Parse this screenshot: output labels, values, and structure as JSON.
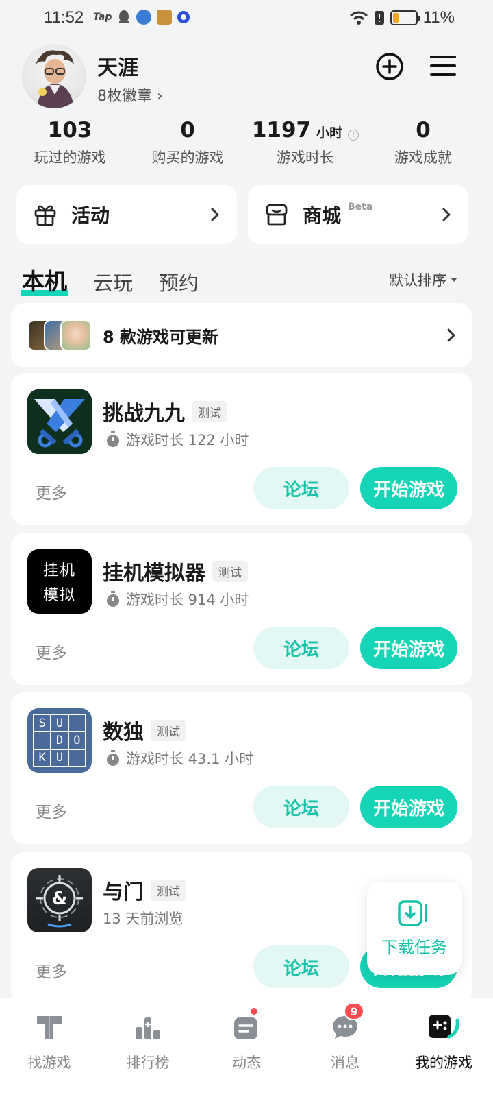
{
  "status_bar": {
    "time": "11:52",
    "tap_label": "Tap",
    "battery_percent": "11%",
    "battery_level": 0.11
  },
  "profile": {
    "username": "天涯",
    "badges": "8枚徽章 ›"
  },
  "stats": [
    {
      "value": "103",
      "unit": "",
      "label": "玩过的游戏"
    },
    {
      "value": "0",
      "unit": "",
      "label": "购买的游戏"
    },
    {
      "value": "1197",
      "unit": "小时",
      "label": "游戏时长"
    },
    {
      "value": "0",
      "unit": "",
      "label": "游戏成就"
    }
  ],
  "actions": {
    "activity": "活动",
    "store": "商城",
    "store_badge": "Beta"
  },
  "tabs": [
    "本机",
    "云玩",
    "预约"
  ],
  "sort_label": "默认排序",
  "update_bar": {
    "text": "8 款游戏可更新"
  },
  "games": [
    {
      "name": "挑战九九",
      "tag": "测试",
      "meta": "游戏时长 122 小时",
      "more": "更多",
      "forum": "论坛",
      "play": "开始游戏"
    },
    {
      "name": "挂机模拟器",
      "tag": "测试",
      "meta": "游戏时长 914 小时",
      "more": "更多",
      "forum": "论坛",
      "play": "开始游戏",
      "icon_text": [
        "挂机",
        "模拟"
      ]
    },
    {
      "name": "数独",
      "tag": "测试",
      "meta": "游戏时长 43.1 小时",
      "more": "更多",
      "forum": "论坛",
      "play": "开始游戏",
      "icon_letters": [
        "S",
        "U",
        "",
        "",
        "D",
        "O",
        "K",
        "U",
        ""
      ]
    },
    {
      "name": "与门",
      "tag": "测试",
      "meta": "13 天前浏览",
      "more": "更多",
      "forum": "论坛",
      "play": "开始游戏"
    }
  ],
  "download_task": "下载任务",
  "bottom_nav": [
    {
      "label": "找游戏"
    },
    {
      "label": "排行榜"
    },
    {
      "label": "动态"
    },
    {
      "label": "消息",
      "badge": "9"
    },
    {
      "label": "我的游戏"
    }
  ],
  "colors": {
    "accent": "#16d4b6",
    "accent_light": "#e3f8f5",
    "background": "#f3f4f6",
    "badge_red": "#ff4d4f"
  }
}
